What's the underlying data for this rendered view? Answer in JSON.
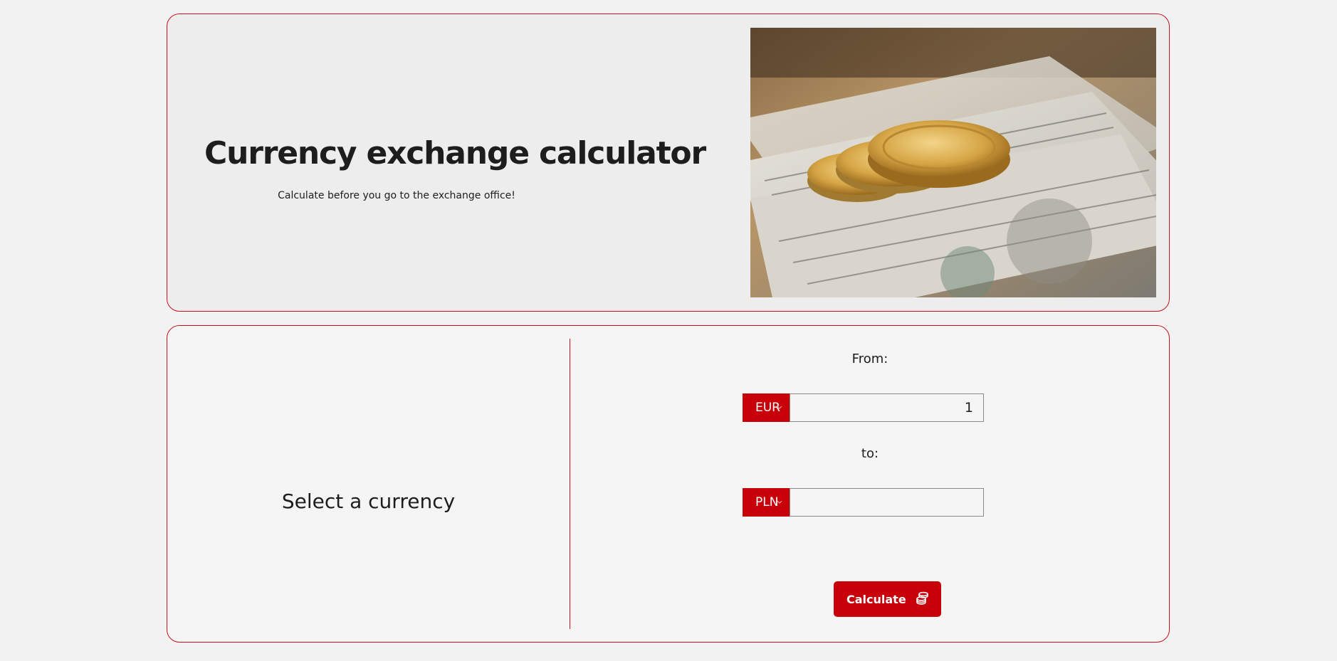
{
  "hero": {
    "title": "Currency exchange calculator",
    "subtitle": "Calculate before you go to the exchange office!",
    "image_icon": "coins-on-dollar-bills-image"
  },
  "calculator": {
    "left_panel_text": "Select a currency",
    "from_label": "From:",
    "to_label": "to:",
    "from_currency": "EUR",
    "from_amount": "1",
    "to_currency": "PLN",
    "to_amount": "",
    "calculate_label": "Calculate",
    "calculate_icon": "coins-icon"
  },
  "colors": {
    "accent": "#c8000a",
    "border": "#c8101e",
    "background": "#f2f2f2",
    "text": "#1d1d1d"
  }
}
